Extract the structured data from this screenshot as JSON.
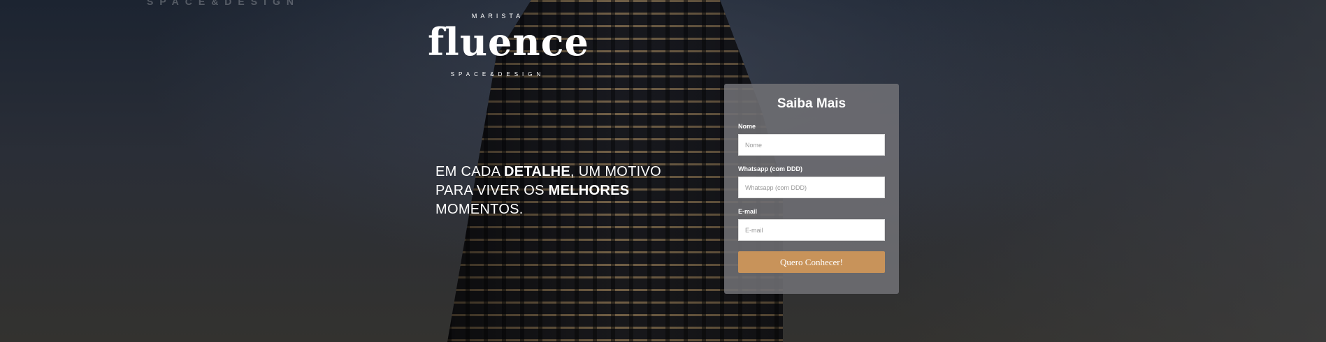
{
  "background": {
    "ghost_logo": "SPACE&DESIGN"
  },
  "logo": {
    "top": "MARISTA",
    "main": "fluence",
    "bottom": "SPACE&DESIGN"
  },
  "headline": {
    "part1": "EM CADA ",
    "bold1": "DETALHE",
    "part2": ", UM MOTIVO PARA VIVER OS ",
    "bold2": "MELHORES",
    "part3": " MOMENTOS."
  },
  "form": {
    "title": "Saiba Mais",
    "fields": [
      {
        "label": "Nome",
        "placeholder": "Nome",
        "value": ""
      },
      {
        "label": "Whatsapp (com DDD)",
        "placeholder": "Whatsapp (com DDD)",
        "value": ""
      },
      {
        "label": "E-mail",
        "placeholder": "E-mail",
        "value": ""
      }
    ],
    "submit_label": "Quero Conhecer!"
  },
  "colors": {
    "accent": "#c8935a",
    "card": "#707074"
  }
}
